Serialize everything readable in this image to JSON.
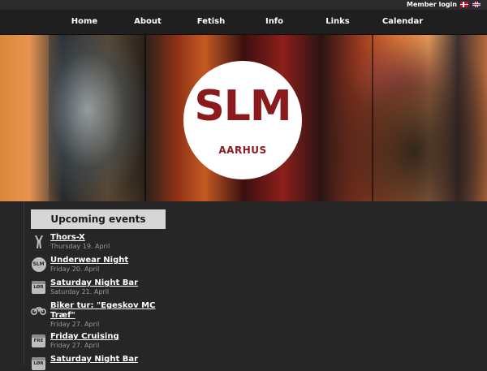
{
  "topbar": {
    "member_login": "Member login"
  },
  "nav": {
    "items": [
      "Home",
      "About",
      "Fetish",
      "Info",
      "Links",
      "Calendar"
    ]
  },
  "logo": {
    "main": "SLM",
    "sub": "AARHUS"
  },
  "events": {
    "header": "Upcoming events",
    "items": [
      {
        "title": "Thors-X",
        "date": "Thursday 19. April",
        "icon": "thor-hammer-icon"
      },
      {
        "title": "Underwear Night",
        "date": "Friday 20. April",
        "icon": "slm-badge-icon",
        "icon_text": "SLM"
      },
      {
        "title": "Saturday Night Bar",
        "date": "Saturday 21. April",
        "icon": "calendar-icon",
        "icon_text": "LØR"
      },
      {
        "title": "Biker tur: \"Egeskov MC Træf\"",
        "date": "Friday 27. April",
        "icon": "motorcycle-icon"
      },
      {
        "title": "Friday Cruising",
        "date": "Friday 27. April",
        "icon": "calendar-icon",
        "icon_text": "FRE"
      },
      {
        "title": "Saturday Night Bar",
        "date": "",
        "icon": "calendar-icon",
        "icon_text": "LØR"
      }
    ]
  },
  "colors": {
    "logo_red": "#8b1a1c",
    "header_bg": "#d6d6d6",
    "page_bg": "#262626"
  }
}
